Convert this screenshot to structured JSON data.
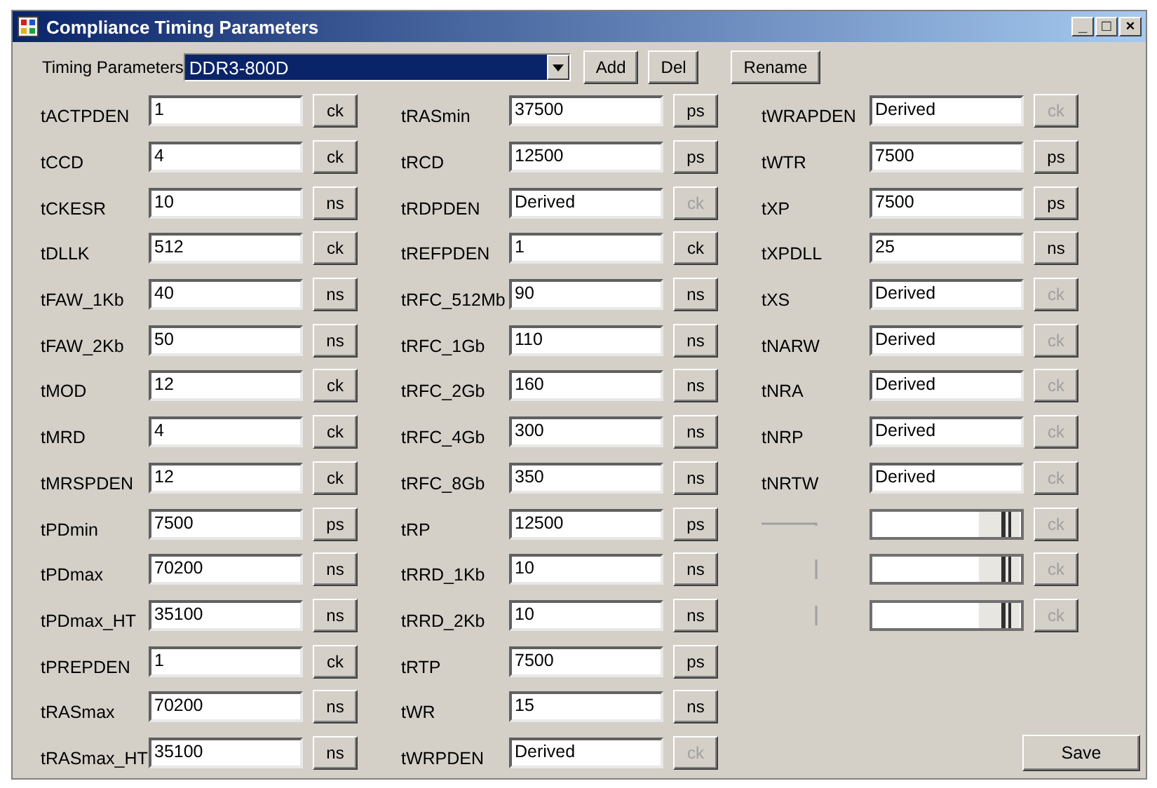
{
  "window": {
    "title": "Compliance Timing Parameters",
    "controls": [
      "_",
      "□",
      "×"
    ]
  },
  "toolbar": {
    "label": "Timing Parameters",
    "combo_value": "DDR3-800D",
    "buttons": [
      "Add",
      "Del",
      "Rename"
    ]
  },
  "columns": [
    [
      {
        "kind": "field",
        "label": "tACTPDEN",
        "value": "1",
        "unit": "ck",
        "disabled": false
      },
      {
        "kind": "field",
        "label": "tCCD",
        "value": "4",
        "unit": "ck",
        "disabled": false
      },
      {
        "kind": "field",
        "label": "tCKESR",
        "value": "10",
        "unit": "ns",
        "disabled": false
      },
      {
        "kind": "field",
        "label": "tDLLK",
        "value": "512",
        "unit": "ck",
        "disabled": false
      },
      {
        "kind": "field",
        "label": "tFAW_1Kb",
        "value": "40",
        "unit": "ns",
        "disabled": false
      },
      {
        "kind": "field",
        "label": "tFAW_2Kb",
        "value": "50",
        "unit": "ns",
        "disabled": false
      },
      {
        "kind": "field",
        "label": "tMOD",
        "value": "12",
        "unit": "ck",
        "disabled": false
      },
      {
        "kind": "field",
        "label": "tMRD",
        "value": "4",
        "unit": "ck",
        "disabled": false
      },
      {
        "kind": "field",
        "label": "tMRSPDEN",
        "value": "12",
        "unit": "ck",
        "disabled": false
      },
      {
        "kind": "field",
        "label": "tPDmin",
        "value": "7500",
        "unit": "ps",
        "disabled": false
      },
      {
        "kind": "field",
        "label": "tPDmax",
        "value": "70200",
        "unit": "ns",
        "disabled": false
      },
      {
        "kind": "field",
        "label": "tPDmax_HT",
        "value": "35100",
        "unit": "ns",
        "disabled": false
      },
      {
        "kind": "field",
        "label": "tPREPDEN",
        "value": "1",
        "unit": "ck",
        "disabled": false
      },
      {
        "kind": "field",
        "label": "tRASmax",
        "value": "70200",
        "unit": "ns",
        "disabled": false
      },
      {
        "kind": "field",
        "label": "tRASmax_HT",
        "value": "35100",
        "unit": "ns",
        "disabled": false
      }
    ],
    [
      {
        "kind": "field",
        "label": "tRASmin",
        "value": "37500",
        "unit": "ps",
        "disabled": false
      },
      {
        "kind": "field",
        "label": "tRCD",
        "value": "12500",
        "unit": "ps",
        "disabled": false
      },
      {
        "kind": "field",
        "label": "tRDPDEN",
        "value": "Derived",
        "unit": "ck",
        "disabled": true
      },
      {
        "kind": "field",
        "label": "tREFPDEN",
        "value": "1",
        "unit": "ck",
        "disabled": false
      },
      {
        "kind": "field",
        "label": "tRFC_512Mb",
        "value": "90",
        "unit": "ns",
        "disabled": false
      },
      {
        "kind": "field",
        "label": "tRFC_1Gb",
        "value": "110",
        "unit": "ns",
        "disabled": false
      },
      {
        "kind": "field",
        "label": "tRFC_2Gb",
        "value": "160",
        "unit": "ns",
        "disabled": false
      },
      {
        "kind": "field",
        "label": "tRFC_4Gb",
        "value": "300",
        "unit": "ns",
        "disabled": false
      },
      {
        "kind": "field",
        "label": "tRFC_8Gb",
        "value": "350",
        "unit": "ns",
        "disabled": false
      },
      {
        "kind": "field",
        "label": "tRP",
        "value": "12500",
        "unit": "ps",
        "disabled": false
      },
      {
        "kind": "field",
        "label": "tRRD_1Kb",
        "value": "10",
        "unit": "ns",
        "disabled": false
      },
      {
        "kind": "field",
        "label": "tRRD_2Kb",
        "value": "10",
        "unit": "ns",
        "disabled": false
      },
      {
        "kind": "field",
        "label": "tRTP",
        "value": "7500",
        "unit": "ps",
        "disabled": false
      },
      {
        "kind": "field",
        "label": "tWR",
        "value": "15",
        "unit": "ns",
        "disabled": false
      },
      {
        "kind": "field",
        "label": "tWRPDEN",
        "value": "Derived",
        "unit": "ck",
        "disabled": true
      }
    ],
    [
      {
        "kind": "field",
        "label": "tWRAPDEN",
        "value": "Derived",
        "unit": "ck",
        "disabled": true
      },
      {
        "kind": "field",
        "label": "tWTR",
        "value": "7500",
        "unit": "ps",
        "disabled": false
      },
      {
        "kind": "field",
        "label": "tXP",
        "value": "7500",
        "unit": "ps",
        "disabled": false
      },
      {
        "kind": "field",
        "label": "tXPDLL",
        "value": "25",
        "unit": "ns",
        "disabled": false
      },
      {
        "kind": "field",
        "label": "tXS",
        "value": "Derived",
        "unit": "ck",
        "disabled": true
      },
      {
        "kind": "field",
        "label": "tNARW",
        "value": "Derived",
        "unit": "ck",
        "disabled": true
      },
      {
        "kind": "field",
        "label": "tNRA",
        "value": "Derived",
        "unit": "ck",
        "disabled": true
      },
      {
        "kind": "field",
        "label": "tNRP",
        "value": "Derived",
        "unit": "ck",
        "disabled": true
      },
      {
        "kind": "field",
        "label": "tNRTW",
        "value": "Derived",
        "unit": "ck",
        "disabled": true
      },
      {
        "kind": "hline",
        "unit": "ck",
        "disabled": true
      },
      {
        "kind": "vline",
        "unit": "ck",
        "disabled": true
      },
      {
        "kind": "vline",
        "unit": "ck",
        "disabled": true
      }
    ]
  ],
  "save_button": "Save"
}
